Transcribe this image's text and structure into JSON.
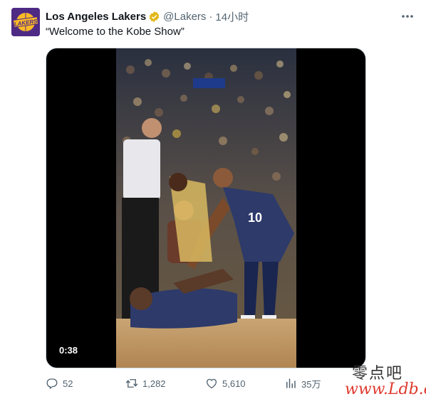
{
  "tweet": {
    "display_name": "Los Angeles Lakers",
    "handle": "@Lakers",
    "separator": "·",
    "time": "14小时",
    "text": "“Welcome to the Kobe Show”",
    "avatar_logo_text": "LAKERS",
    "verified_icon": "verified-badge-icon",
    "more_icon": "more-options-icon",
    "colors": {
      "lakers_purple": "#4e2a84",
      "lakers_gold": "#fdb927",
      "verified_gold": "#e2b719",
      "muted": "#536471"
    }
  },
  "media": {
    "duration": "0:38",
    "jersey_number": "10"
  },
  "actions": {
    "reply_count": "52",
    "retweet_count": "1,282",
    "like_count": "5,610",
    "views_count": "35万",
    "icons": [
      "reply-icon",
      "retweet-icon",
      "like-icon",
      "views-icon"
    ]
  },
  "watermark": {
    "chinese": "零点吧",
    "url": "www.Ldb.cc"
  }
}
